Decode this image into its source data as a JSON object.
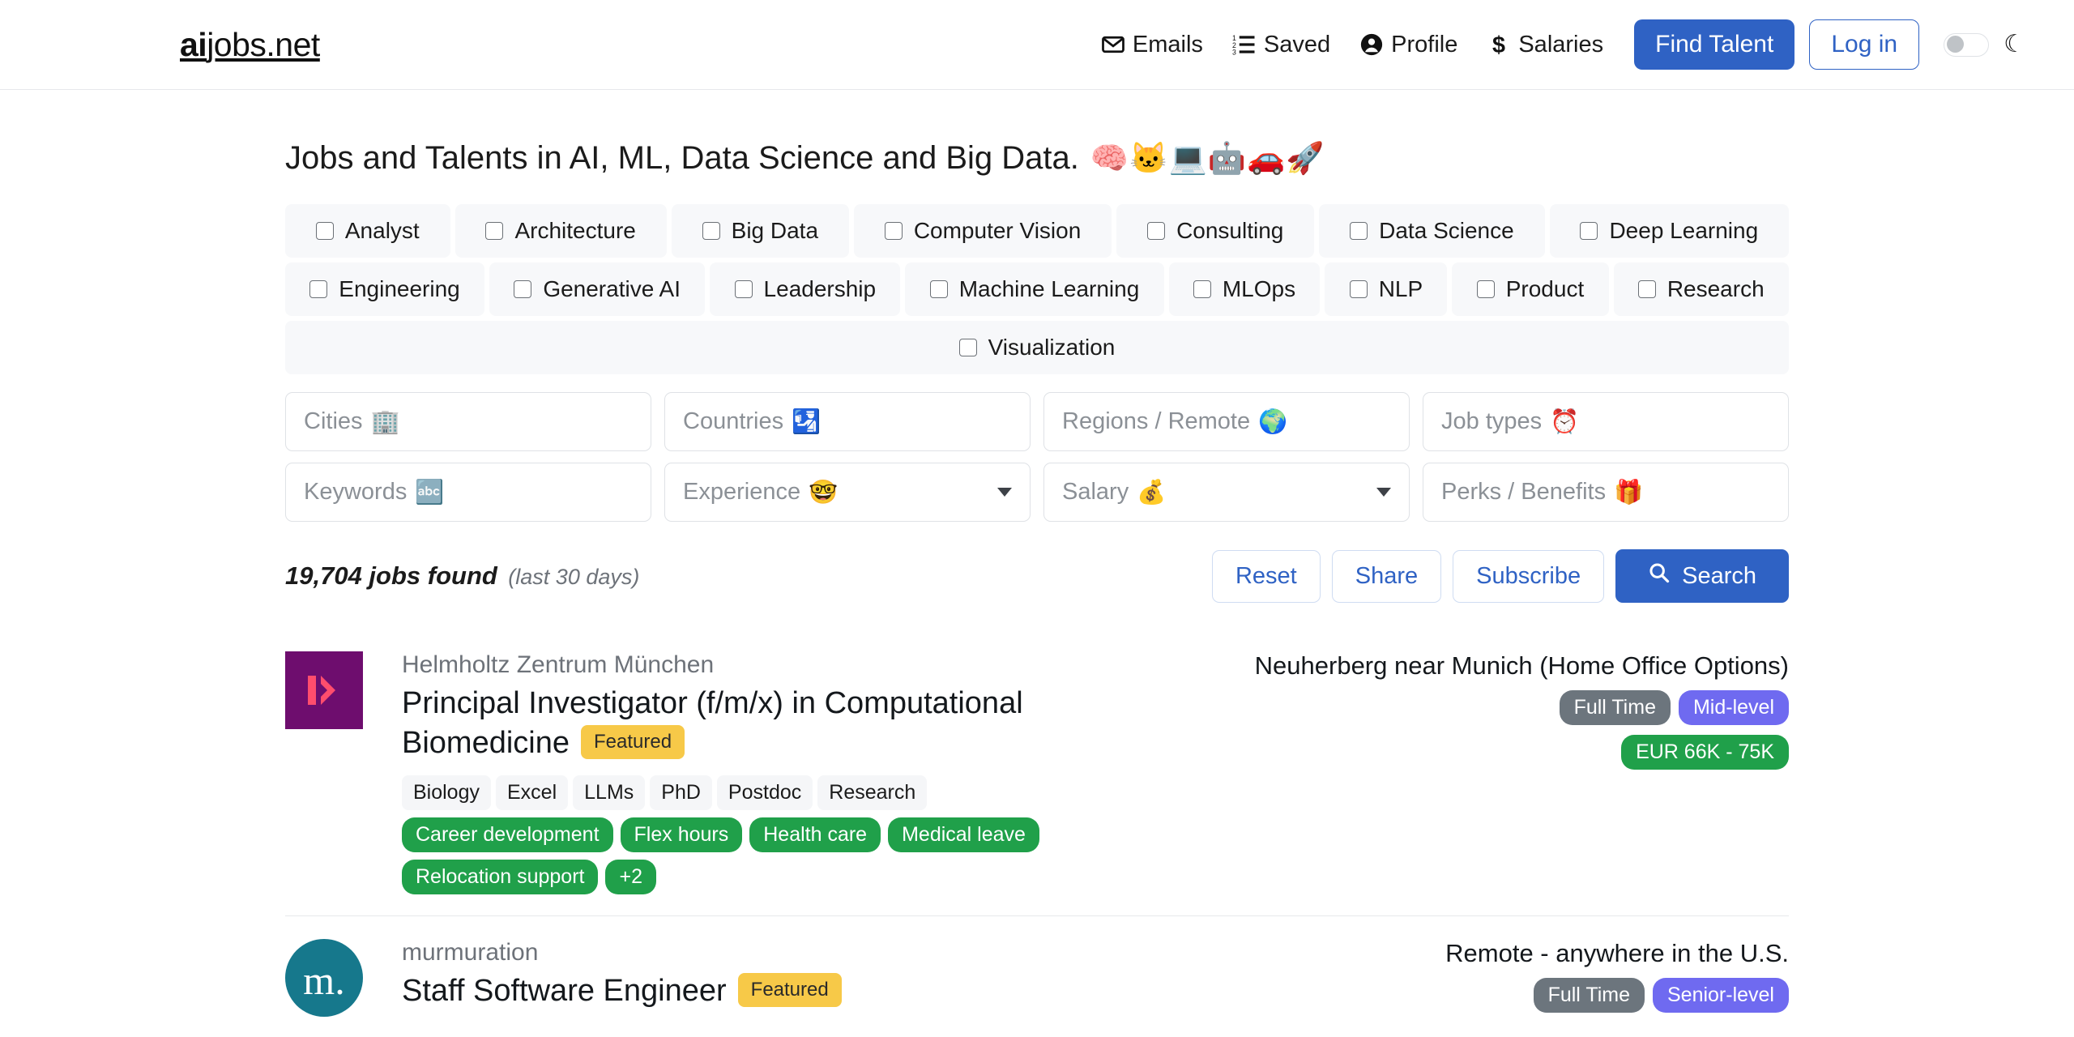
{
  "header": {
    "brand_bold": "ai",
    "brand_rest": "jobs.net",
    "nav": [
      {
        "label": "Emails",
        "icon": "envelope-icon"
      },
      {
        "label": "Saved",
        "icon": "list-ol-icon"
      },
      {
        "label": "Profile",
        "icon": "user-circle-icon"
      },
      {
        "label": "Salaries",
        "icon": "dollar-icon"
      }
    ],
    "find_talent_label": "Find Talent",
    "login_label": "Log in",
    "theme_toggle_state": "off",
    "theme_icon": "moon-icon",
    "accent_color": "#2f62c4"
  },
  "main": {
    "title": "Jobs and Talents in AI, ML, Data Science and Big Data.",
    "title_emojis": "🧠🐱💻🤖🚗🚀",
    "categories_row1": [
      "Analyst",
      "Architecture",
      "Big Data",
      "Computer Vision",
      "Consulting",
      "Data Science",
      "Deep Learning"
    ],
    "categories_row2": [
      "Engineering",
      "Generative AI",
      "Leadership",
      "Machine Learning",
      "MLOps",
      "NLP",
      "Product",
      "Research"
    ],
    "categories_row3": [
      "Visualization"
    ],
    "filters_row1": [
      {
        "placeholder": "Cities",
        "emoji": "🏢",
        "type": "text"
      },
      {
        "placeholder": "Countries",
        "emoji": "🛂",
        "type": "text"
      },
      {
        "placeholder": "Regions / Remote",
        "emoji": "🌍",
        "type": "text"
      },
      {
        "placeholder": "Job types",
        "emoji": "⏰",
        "type": "text"
      }
    ],
    "filters_row2": [
      {
        "placeholder": "Keywords",
        "emoji": "🔤",
        "type": "text"
      },
      {
        "placeholder": "Experience",
        "emoji": "🤓",
        "type": "select"
      },
      {
        "placeholder": "Salary",
        "emoji": "💰",
        "type": "select"
      },
      {
        "placeholder": "Perks / Benefits",
        "emoji": "🎁",
        "type": "text"
      }
    ],
    "results_count": "19,704 jobs found",
    "results_period": "(last 30 days)",
    "actions": {
      "reset": "Reset",
      "share": "Share",
      "subscribe": "Subscribe",
      "search": "Search",
      "search_icon": "search-icon"
    }
  },
  "jobs": [
    {
      "company": "Helmholtz Zentrum München",
      "title": "Principal Investigator (f/m/x) in Computational Biomedicine",
      "featured_label": "Featured",
      "logo": {
        "kind": "square",
        "glyph": "⊦➤",
        "bg": "#6e0d6e",
        "fg": "#ff4d6d"
      },
      "location": "Neuherberg near Munich (Home Office Options)",
      "pills": [
        {
          "label": "Full Time",
          "color": "#6c757d"
        },
        {
          "label": "Mid-level",
          "color": "#6f6af0"
        }
      ],
      "salary": {
        "label": "EUR 66K - 75K",
        "color": "#20a04a"
      },
      "tags": [
        "Biology",
        "Excel",
        "LLMs",
        "PhD",
        "Postdoc",
        "Research"
      ],
      "perks": [
        "Career development",
        "Flex hours",
        "Health care",
        "Medical leave",
        "Relocation support",
        "+2"
      ]
    },
    {
      "company": "murmuration",
      "title": "Staff Software Engineer",
      "featured_label": "Featured",
      "logo": {
        "kind": "circle",
        "glyph": "m.",
        "bg": "#16788c",
        "fg": "#ffffff"
      },
      "location": "Remote - anywhere in the U.S.",
      "pills": [
        {
          "label": "Full Time",
          "color": "#6c757d"
        },
        {
          "label": "Senior-level",
          "color": "#6f6af0"
        }
      ],
      "salary": null,
      "tags": [],
      "perks": []
    }
  ]
}
